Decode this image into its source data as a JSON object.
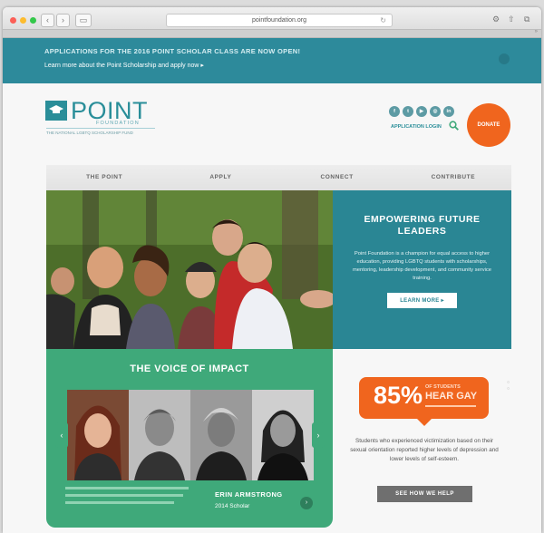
{
  "browser": {
    "url": "pointfoundation.org"
  },
  "banner": {
    "title": "APPLICATIONS FOR THE 2016 POINT SCHOLAR CLASS ARE NOW OPEN!",
    "link": "Learn more about the Point Scholarship and apply now ▸"
  },
  "logo": {
    "word": "POINT",
    "sub": "FOUNDATION",
    "tagline": "THE NATIONAL LGBTQ SCHOLARSHIP FUND"
  },
  "header": {
    "application_login": "APPLICATION LOGIN",
    "donate": "DONATE"
  },
  "nav": {
    "items": [
      "THE POINT",
      "APPLY",
      "CONNECT",
      "CONTRIBUTE"
    ]
  },
  "hero": {
    "title": "EMPOWERING FUTURE LEADERS",
    "body": "Point Foundation is a champion for equal access to higher education, providing LGBTQ students with scholarships, mentoring, leadership development, and community service training.",
    "button": "LEARN MORE ▸"
  },
  "voice": {
    "title": "THE VOICE OF IMPACT",
    "name": "ERIN ARMSTRONG",
    "role": "2014 Scholar"
  },
  "stats": {
    "percent": "85%",
    "line1": "OF STUDENTS",
    "line2": "HEAR GAY",
    "text": "Students who experienced victimization based on their sexual orientation reported higher levels of depression and lower levels of self-esteem.",
    "button": "SEE HOW WE HELP"
  },
  "colors": {
    "teal": "#2a8694",
    "green": "#3fa97a",
    "orange": "#f0651e"
  }
}
